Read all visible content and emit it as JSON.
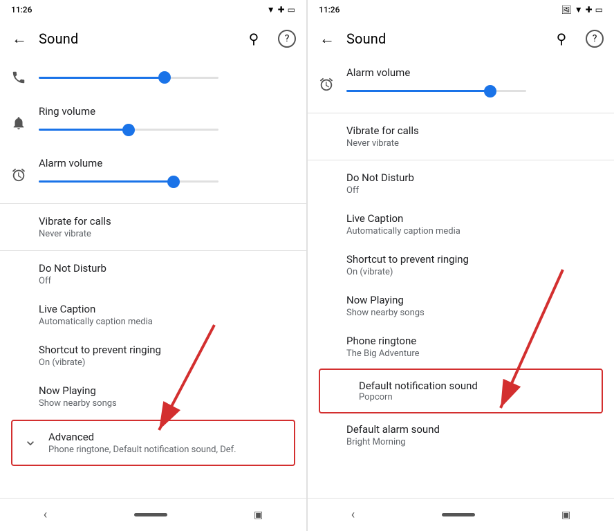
{
  "left_panel": {
    "status_bar": {
      "time": "11:26",
      "icons": [
        "wifi",
        "signal",
        "battery"
      ]
    },
    "title": "Sound",
    "back_label": "←",
    "search_label": "🔍",
    "help_label": "?",
    "settings": [
      {
        "id": "media-volume",
        "icon": "phone",
        "has_slider": true,
        "slider_pct": 70,
        "label": "",
        "sublabel": ""
      },
      {
        "id": "ring-volume",
        "icon": "bell",
        "has_slider": true,
        "slider_pct": 50,
        "label": "Ring volume",
        "sublabel": ""
      },
      {
        "id": "alarm-volume",
        "icon": "alarm",
        "has_slider": true,
        "slider_pct": 75,
        "label": "Alarm volume",
        "sublabel": ""
      }
    ],
    "menu_items": [
      {
        "id": "vibrate-calls",
        "label": "Vibrate for calls",
        "sublabel": "Never vibrate"
      },
      {
        "id": "do-not-disturb",
        "label": "Do Not Disturb",
        "sublabel": "Off"
      },
      {
        "id": "live-caption",
        "label": "Live Caption",
        "sublabel": "Automatically caption media"
      },
      {
        "id": "shortcut-ringing",
        "label": "Shortcut to prevent ringing",
        "sublabel": "On (vibrate)"
      },
      {
        "id": "now-playing",
        "label": "Now Playing",
        "sublabel": "Show nearby songs"
      }
    ],
    "advanced": {
      "label": "Advanced",
      "sublabel": "Phone ringtone, Default notification sound, Def.",
      "icon": "chevron-down"
    }
  },
  "right_panel": {
    "status_bar": {
      "time": "11:26",
      "icons": [
        "image",
        "wifi",
        "signal",
        "battery"
      ]
    },
    "title": "Sound",
    "back_label": "←",
    "search_label": "🔍",
    "help_label": "?",
    "alarm_volume": {
      "icon": "alarm",
      "label": "Alarm volume",
      "slider_pct": 80
    },
    "menu_items": [
      {
        "id": "vibrate-calls",
        "label": "Vibrate for calls",
        "sublabel": "Never vibrate"
      },
      {
        "id": "do-not-disturb",
        "label": "Do Not Disturb",
        "sublabel": "Off"
      },
      {
        "id": "live-caption",
        "label": "Live Caption",
        "sublabel": "Automatically caption media"
      },
      {
        "id": "shortcut-ringing",
        "label": "Shortcut to prevent ringing",
        "sublabel": "On (vibrate)"
      },
      {
        "id": "now-playing",
        "label": "Now Playing",
        "sublabel": "Show nearby songs"
      },
      {
        "id": "phone-ringtone",
        "label": "Phone ringtone",
        "sublabel": "The Big Adventure"
      }
    ],
    "highlighted_item": {
      "id": "default-notification-sound",
      "label": "Default notification sound",
      "sublabel": "Popcorn"
    },
    "default_alarm_sound": {
      "id": "default-alarm-sound",
      "label": "Default alarm sound",
      "sublabel": "Bright Morning"
    }
  },
  "icons": {
    "back": "←",
    "search": "⌕",
    "help": "?",
    "chevron_down": "⌄",
    "phone": "📞",
    "bell": "🔔",
    "alarm": "⏰",
    "back_nav": "‹",
    "home": "●",
    "recents": "▣"
  }
}
